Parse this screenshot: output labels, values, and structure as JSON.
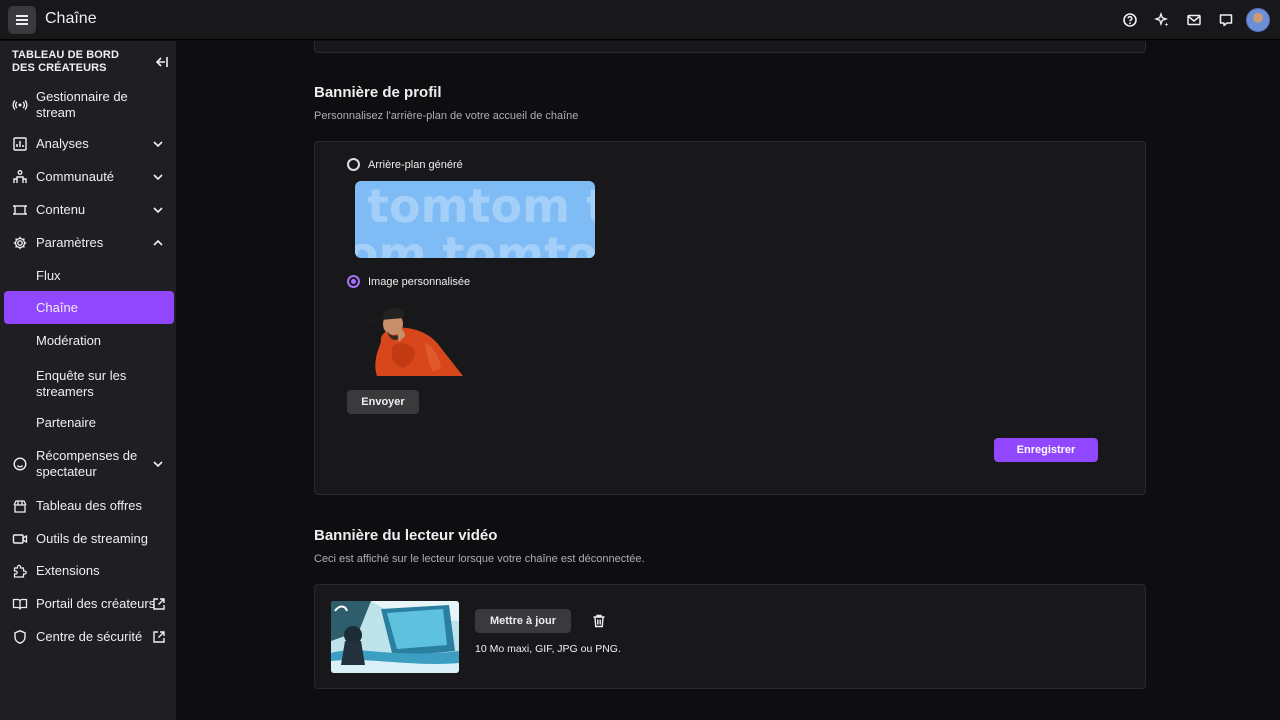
{
  "app": {
    "title": "Chaîne"
  },
  "topbar": {
    "icons": [
      "help-icon",
      "sparkle-icon",
      "inbox-icon",
      "whispers-icon"
    ]
  },
  "sidebar": {
    "header": "TABLEAU DE BORD DES CRÉATEURS",
    "items": [
      {
        "label": "Gestionnaire de stream",
        "icon": "broadcast-icon"
      },
      {
        "label": "Analyses",
        "icon": "analytics-icon",
        "expandable": true
      },
      {
        "label": "Communauté",
        "icon": "community-icon",
        "expandable": true
      },
      {
        "label": "Contenu",
        "icon": "content-icon",
        "expandable": true
      },
      {
        "label": "Paramètres",
        "icon": "settings-icon",
        "expanded": true
      },
      {
        "label": "Flux"
      },
      {
        "label": "Chaîne",
        "active": true
      },
      {
        "label": "Modération"
      },
      {
        "label": "Enquête sur les streamers"
      },
      {
        "label": "Partenaire"
      },
      {
        "label": "Récompenses de spectateur",
        "icon": "rewards-icon",
        "expandable": true
      },
      {
        "label": "Tableau des offres",
        "icon": "offers-icon"
      },
      {
        "label": "Outils de streaming",
        "icon": "camera-icon"
      },
      {
        "label": "Extensions",
        "icon": "puzzle-icon"
      },
      {
        "label": "Portail des créateurs",
        "icon": "book-icon",
        "external": true
      },
      {
        "label": "Centre de sécurité",
        "icon": "shield-icon",
        "external": true
      }
    ]
  },
  "profile_banner": {
    "title": "Bannière de profil",
    "subtitle": "Personnalisez l'arrière-plan de votre accueil de chaîne",
    "option_generated": "Arrière-plan généré",
    "generated_text_line1": "tomtom tomtom",
    "generated_text_line2": "om tomtom to",
    "option_custom": "Image personnalisée",
    "selected": "custom",
    "upload_label": "Envoyer",
    "save_label": "Enregistrer",
    "accent": "#9147ff"
  },
  "video_banner": {
    "title": "Bannière du lecteur vidéo",
    "subtitle": "Ceci est affiché sur le lecteur lorsque votre chaîne est déconnectée.",
    "update_label": "Mettre à jour",
    "hint": "10 Mo maxi, GIF, JPG ou PNG."
  }
}
